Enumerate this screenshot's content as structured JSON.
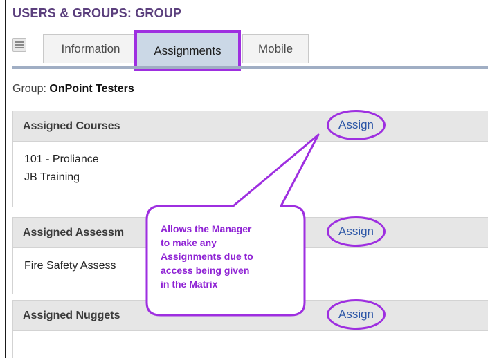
{
  "page": {
    "title": "USERS & GROUPS: GROUP"
  },
  "tabs": [
    {
      "label": "Information",
      "active": false
    },
    {
      "label": "Assignments",
      "active": true
    },
    {
      "label": "Mobile",
      "active": false
    }
  ],
  "group": {
    "prefix": "Group:",
    "name": "OnPoint Testers"
  },
  "panels": {
    "courses": {
      "title": "Assigned Courses",
      "assign_label": "Assign",
      "items": [
        "101 - Proliance",
        "JB Training"
      ]
    },
    "assessments": {
      "title": "Assigned Assessm",
      "assign_label": "Assign",
      "items": [
        "Fire Safety Assess"
      ]
    },
    "nuggets": {
      "title": "Assigned Nuggets",
      "assign_label": "Assign",
      "items": []
    }
  },
  "callout": {
    "text": "Allows the Manager\nto make any\nAssignments due to\naccess being given\nin the Matrix",
    "color": "#9e2fe0"
  },
  "colors": {
    "accent": "#9e2fe0",
    "title": "#5b3f7d",
    "link": "#2d57a7",
    "active_tab": "#cbd8e6"
  },
  "icons": {
    "menu": "hamburger-menu-icon"
  }
}
